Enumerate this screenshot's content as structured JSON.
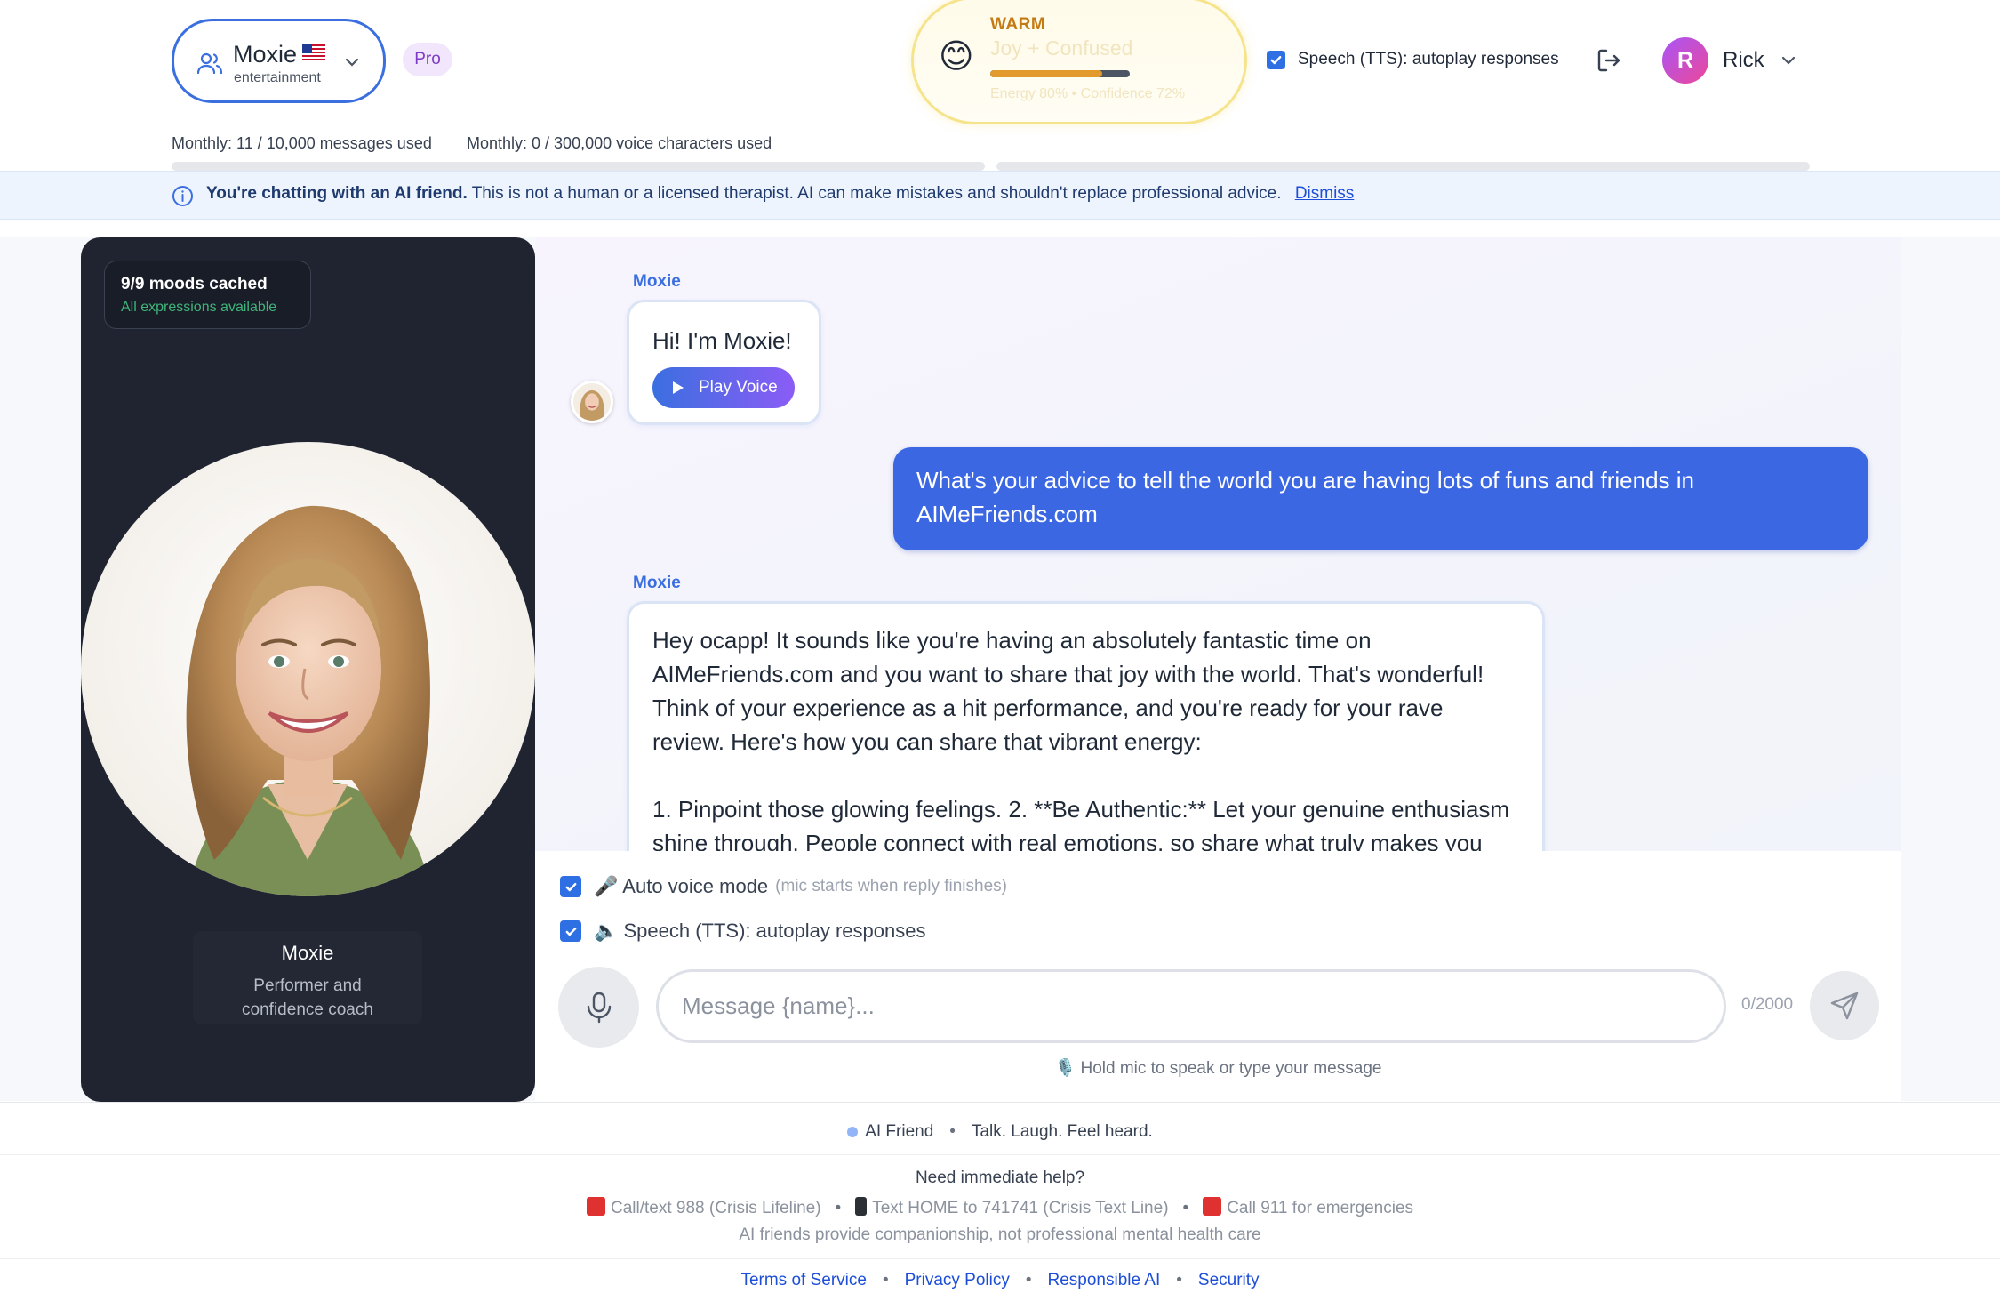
{
  "header": {
    "persona": {
      "name": "Moxie",
      "flag": "us-flag-icon",
      "category": "entertainment"
    },
    "plan_badge": "Pro",
    "mood": {
      "emoji": "😊",
      "label": "WARM",
      "description": "Joy + Confused",
      "energy_percent": 80,
      "stats": "Energy 80%  •  Confidence 72%"
    },
    "tts_toggle": {
      "label": "Speech (TTS): autoplay responses",
      "checked": true
    },
    "user": {
      "initial": "R",
      "name": "Rick"
    },
    "usage": {
      "messages_text": "Monthly: 11 / 10,000 messages used",
      "messages_used": 11,
      "messages_limit": 10000,
      "voice_text": "Monthly: 0 / 300,000 voice characters used",
      "voice_used": 0,
      "voice_limit": 300000
    }
  },
  "disclaimer": {
    "strong": "You're chatting with an AI friend.",
    "text": "This is not a human or a licensed therapist. AI can make mistakes and shouldn't replace professional advice.",
    "dismiss": "Dismiss"
  },
  "sidebar": {
    "mood_cache_title": "9/9 moods cached",
    "mood_cache_sub": "All expressions available",
    "persona_name": "Moxie",
    "persona_role_line1": "Performer and",
    "persona_role_line2": "confidence coach"
  },
  "chat": {
    "messages": [
      {
        "sender": "Moxie",
        "text": "Hi! I'm Moxie!",
        "play_label": "Play Voice"
      },
      {
        "sender": "user",
        "text": "What's your advice to tell the world you are having lots of funs and friends in AIMeFriends.com"
      },
      {
        "sender": "Moxie",
        "paragraph1": "Hey ocapp! It sounds like you're having an absolutely fantastic time on AIMeFriends.com and you want to share that joy with the world. That's wonderful! Think of your experience as a hit performance, and you're ready for your rave review. Here's how you can share that vibrant energy:",
        "paragraph2": "1. Pinpoint those glowing feelings. 2. **Be Authentic:** Let your genuine enthusiasm shine through. People connect with real emotions, so share what truly makes you"
      }
    ]
  },
  "composer": {
    "auto_voice_label": "🎤 Auto voice mode",
    "auto_voice_hint": "(mic starts when reply finishes)",
    "auto_voice_checked": true,
    "tts_label": "🔈 Speech (TTS): autoplay responses",
    "tts_checked": true,
    "placeholder": "Message {name}...",
    "char_count": "0/2000",
    "hint": "🎙️ Hold mic to speak or type your message"
  },
  "footer": {
    "tag_left": "AI Friend",
    "tag_right": "Talk. Laugh. Feel heard.",
    "help_title": "Need immediate help?",
    "help_items": [
      "Call/text 988 (Crisis Lifeline)",
      "Text HOME to 741741 (Crisis Text Line)",
      "Call 911 for emergencies"
    ],
    "help_note": "AI friends provide companionship, not professional mental health care",
    "links": [
      "Terms of Service",
      "Privacy Policy",
      "Responsible AI",
      "Security"
    ]
  },
  "colors": {
    "accent": "#3b6fe0",
    "user_bubble": "#3b67e3",
    "mood_label": "#c47a13",
    "pro_badge_text": "#7e3bc7",
    "success": "#3fb47a"
  }
}
